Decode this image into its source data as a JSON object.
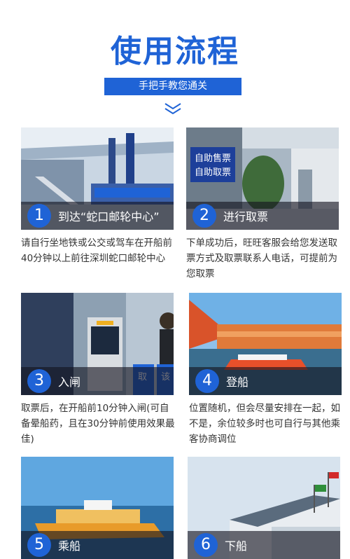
{
  "header": {
    "title": "使用流程",
    "subtitle": "手把手教您通关"
  },
  "icons": {
    "chevron": "double-chevron-down-icon"
  },
  "colors": {
    "accent": "#1f63d6",
    "text": "#333333"
  },
  "steps": [
    {
      "number": "1",
      "label": "到达“蛇口邮轮中心”",
      "desc": "请自行坐地铁或公交或驾车在开船前40分钟以上前往深圳蛇口邮轮中心"
    },
    {
      "number": "2",
      "label": "进行取票",
      "desc": "下单成功后，旺旺客服会给您发送取票方式及取票联系人电话，可提前为您取票",
      "sign_text_1": "自助售票",
      "sign_text_2": "自助取票"
    },
    {
      "number": "3",
      "label": "入闸",
      "desc": "取票后，在开船前10分钟入闸(可自备晕船药，且在30分钟前使用效果最佳)",
      "gate_text_1": "取",
      "gate_text_2": "该"
    },
    {
      "number": "4",
      "label": "登船",
      "desc": "位置随机，但会尽量安排在一起，如不是，余位较多时也可自行与其他乘客协商调位"
    },
    {
      "number": "5",
      "label": "乘船"
    },
    {
      "number": "6",
      "label": "下船"
    }
  ]
}
